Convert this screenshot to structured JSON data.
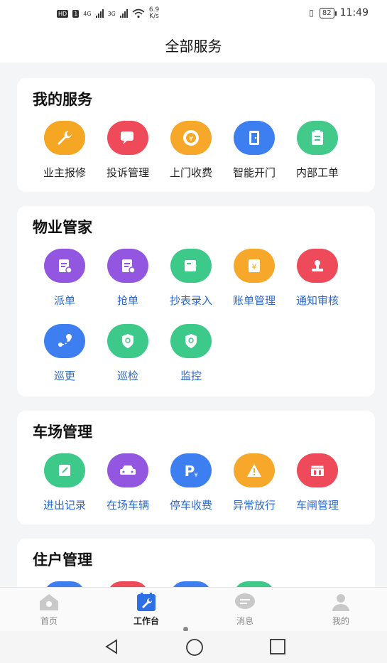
{
  "status_bar": {
    "hd": "HD",
    "sim1": "1",
    "net1": "4G",
    "net2": "3G",
    "speed_value": "6.9",
    "speed_unit": "K/s",
    "battery": "82",
    "time": "11:49"
  },
  "header": {
    "title": "全部服务"
  },
  "sections": [
    {
      "title": "我的服务",
      "items": [
        {
          "label": "业主报修",
          "icon": "wrench-icon",
          "color": "#f5a623"
        },
        {
          "label": "投诉管理",
          "icon": "chat-icon",
          "color": "#ef4a5a"
        },
        {
          "label": "上门收费",
          "icon": "coin-icon",
          "color": "#f7a82b"
        },
        {
          "label": "智能开门",
          "icon": "door-icon",
          "color": "#3d7ff0"
        },
        {
          "label": "内部工单",
          "icon": "clipboard-icon",
          "color": "#43c98a"
        }
      ]
    },
    {
      "title": "物业管家",
      "items": [
        {
          "label": "派单",
          "icon": "dispatch-icon",
          "color": "#9256e0"
        },
        {
          "label": "抢单",
          "icon": "grab-order-icon",
          "color": "#9256e0"
        },
        {
          "label": "抄表录入",
          "icon": "meter-icon",
          "color": "#3dc98a"
        },
        {
          "label": "账单管理",
          "icon": "bill-icon",
          "color": "#f7a82b"
        },
        {
          "label": "通知审核",
          "icon": "stamp-icon",
          "color": "#ef4a5a"
        },
        {
          "label": "巡更",
          "icon": "route-icon",
          "color": "#3d7ff0"
        },
        {
          "label": "巡检",
          "icon": "inspect-icon",
          "color": "#3dc98a"
        },
        {
          "label": "监控",
          "icon": "monitor-icon",
          "color": "#3dc98a"
        }
      ]
    },
    {
      "title": "车场管理",
      "items": [
        {
          "label": "进出记录",
          "icon": "record-icon",
          "color": "#3dc98a"
        },
        {
          "label": "在场车辆",
          "icon": "car-icon",
          "color": "#9256e0"
        },
        {
          "label": "停车收费",
          "icon": "parking-icon",
          "color": "#3d7ff0"
        },
        {
          "label": "异常放行",
          "icon": "warning-icon",
          "color": "#f7a82b"
        },
        {
          "label": "车闸管理",
          "icon": "gate-icon",
          "color": "#ef4a5a"
        }
      ]
    },
    {
      "title": "住户管理",
      "items": []
    }
  ],
  "tabs": [
    {
      "label": "首页",
      "icon": "home-icon",
      "active": false
    },
    {
      "label": "工作台",
      "icon": "workbench-icon",
      "active": true
    },
    {
      "label": "消息",
      "icon": "message-icon",
      "active": false
    },
    {
      "label": "我的",
      "icon": "profile-icon",
      "active": false
    }
  ]
}
